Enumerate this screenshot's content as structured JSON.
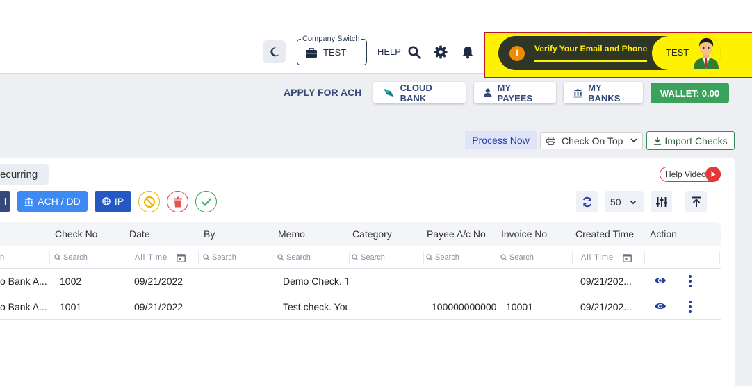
{
  "header": {
    "company_switch_label": "Company Switch",
    "company_switch_value": "TEST",
    "help_label": "HELP",
    "verify_text": "Verify Your Email and Phone",
    "user_label": "TEST",
    "info_glyph": "i"
  },
  "actions": {
    "apply_ach": "APPLY FOR ACH",
    "cloud_bank": "CLOUD BANK",
    "my_payees": "MY PAYEES",
    "my_banks": "MY BANKS",
    "wallet": "WALLET: 0.00"
  },
  "toolbar": {
    "process_now": "Process Now",
    "check_on_top": "Check On Top",
    "import_checks": "Import Checks"
  },
  "card": {
    "tab_label": "ecurring",
    "help_video": "Help Video",
    "btn_partial": "l",
    "ach_dd": "ACH / DD",
    "ip": "IP",
    "per_page": "50"
  },
  "table": {
    "columns": [
      "Check No",
      "Date",
      "By",
      "Memo",
      "Category",
      "Payee A/c No",
      "Invoice No",
      "Created Time",
      "Action"
    ],
    "search_placeholder": "Search",
    "search_partial": "h",
    "all_time": "All Time",
    "rows": [
      {
        "bank": "o Bank A...",
        "check_no": "1002",
        "date": "09/21/2022",
        "by": "",
        "memo": "Demo Check. T",
        "category": "",
        "payee_ac": "",
        "invoice": "",
        "created": "09/21/202..."
      },
      {
        "bank": "o Bank A...",
        "check_no": "1001",
        "date": "09/21/2022",
        "by": "",
        "memo": "Test check. You",
        "category": "",
        "payee_ac": "100000000000",
        "invoice": "10001",
        "created": "09/21/202..."
      }
    ]
  },
  "colors": {
    "navy": "#34497a",
    "wallet_green": "#3aa25a",
    "verify_yellow": "#fff200",
    "ach_blue": "#3d8bf2",
    "ip_blue": "#2459c4",
    "danger_red": "#e04444"
  }
}
